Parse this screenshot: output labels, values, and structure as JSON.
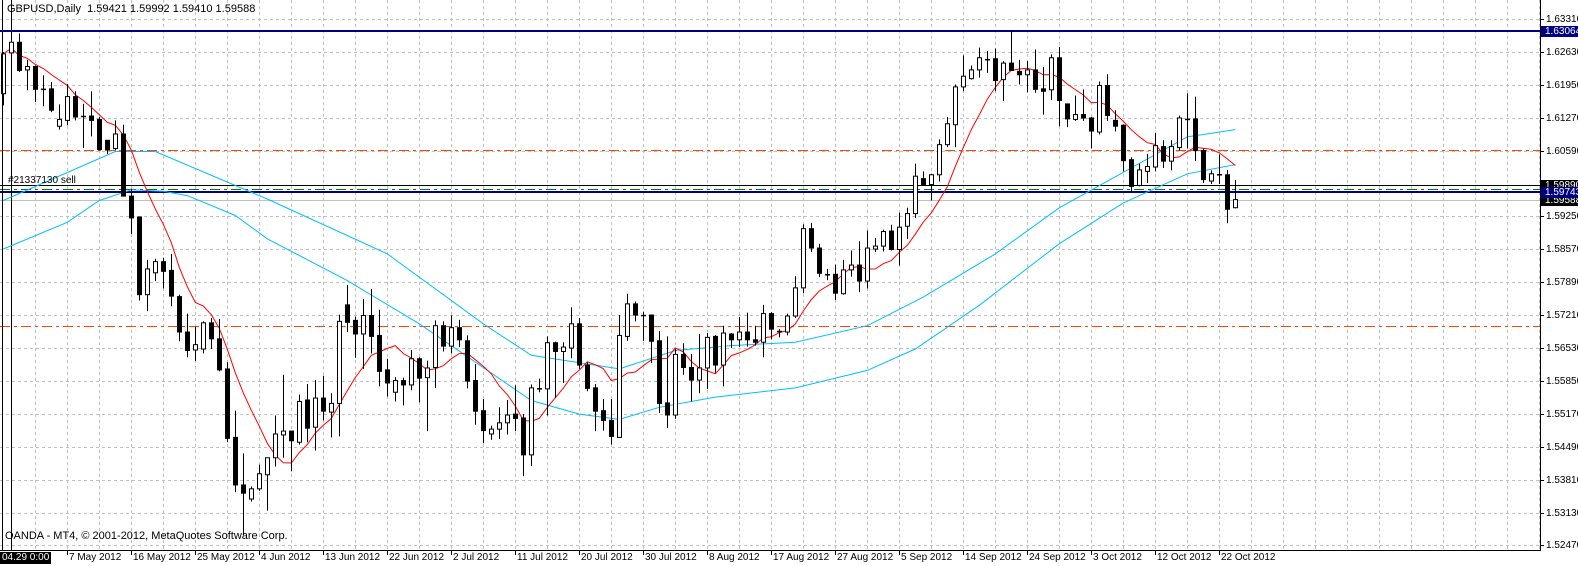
{
  "header": {
    "symbol_timeframe": "GBPUSD,Daily",
    "ohlc": "1.59421 1.59992 1.59410 1.59588"
  },
  "order_label": "#21337130 sell",
  "watermark": "OANDA - MT4, © 2001-2012, MetaQuotes Software Corp.",
  "cursor_time_label": "04.29 0:00",
  "colors": {
    "background": "#ffffff",
    "grid": "#c0c0c0",
    "bull_body": "#ffffff",
    "bear_body": "#000000",
    "candle_outline": "#000000",
    "fast_ma": "#ff0000",
    "slow_ma": "#00bfff",
    "level_line": "#ff4500",
    "resistance_line": "#000080",
    "order_line": "#008000",
    "bid_line": "#c0c0c0"
  },
  "chart_data": {
    "type": "candlestick",
    "title": "GBPUSD,Daily",
    "ylim": [
      1.5237,
      1.637
    ],
    "grid": true,
    "y_ticks": [
      "1.63310",
      "1.62630",
      "1.61950",
      "1.61270",
      "1.60590",
      "1.59250",
      "1.58570",
      "1.57890",
      "1.57210",
      "1.56530",
      "1.55850",
      "1.55170",
      "1.54490",
      "1.53810",
      "1.53130",
      "1.52470"
    ],
    "x_ticks": [
      "7 May 2012",
      "16 May 2012",
      "25 May 2012",
      "4 Jun 2012",
      "13 Jun 2012",
      "22 Jun 2012",
      "2 Jul 2012",
      "11 Jul 2012",
      "20 Jul 2012",
      "30 Jul 2012",
      "8 Aug 2012",
      "17 Aug 2012",
      "27 Aug 2012",
      "5 Sep 2012",
      "14 Sep 2012",
      "24 Sep 2012",
      "3 Oct 2012",
      "12 Oct 2012",
      "22 Oct 2012"
    ],
    "candles_ohlc": [
      [
        1.6177,
        1.6263,
        1.6153,
        1.6259
      ],
      [
        1.6261,
        1.6287,
        1.6246,
        1.6283
      ],
      [
        1.6283,
        1.6301,
        1.6222,
        1.6225
      ],
      [
        1.6226,
        1.6247,
        1.6184,
        1.6233
      ],
      [
        1.6233,
        1.6235,
        1.616,
        1.6186
      ],
      [
        1.6187,
        1.6215,
        1.6151,
        1.6187
      ],
      [
        1.6187,
        1.6201,
        1.6139,
        1.6143
      ],
      [
        1.611,
        1.6155,
        1.6103,
        1.6124
      ],
      [
        1.6122,
        1.6197,
        1.6112,
        1.6171
      ],
      [
        1.6171,
        1.6182,
        1.6122,
        1.6129
      ],
      [
        1.6131,
        1.6156,
        1.6065,
        1.6131
      ],
      [
        1.6131,
        1.6182,
        1.6089,
        1.6122
      ],
      [
        1.6124,
        1.6129,
        1.606,
        1.6062
      ],
      [
        1.6081,
        1.6081,
        1.6053,
        1.6062
      ],
      [
        1.6064,
        1.6122,
        1.606,
        1.6094
      ],
      [
        1.6094,
        1.6113,
        1.5966,
        1.5966
      ],
      [
        1.5966,
        1.5981,
        1.5888,
        1.5921
      ],
      [
        1.5923,
        1.5923,
        1.5751,
        1.5763
      ],
      [
        1.5763,
        1.5835,
        1.5729,
        1.5816
      ],
      [
        1.5808,
        1.5837,
        1.5791,
        1.5831
      ],
      [
        1.5831,
        1.5839,
        1.5776,
        1.5811
      ],
      [
        1.5813,
        1.5847,
        1.5739,
        1.576
      ],
      [
        1.5759,
        1.5763,
        1.5667,
        1.5686
      ],
      [
        1.5686,
        1.5724,
        1.5634,
        1.5648
      ],
      [
        1.5649,
        1.5697,
        1.5626,
        1.566
      ],
      [
        1.5651,
        1.5708,
        1.5642,
        1.5705
      ],
      [
        1.5705,
        1.5715,
        1.5651,
        1.5672
      ],
      [
        1.5672,
        1.5713,
        1.5605,
        1.5608
      ],
      [
        1.561,
        1.5624,
        1.5459,
        1.5467
      ],
      [
        1.5469,
        1.5524,
        1.5356,
        1.5371
      ],
      [
        1.5371,
        1.5436,
        1.5267,
        1.5354
      ],
      [
        1.5342,
        1.5368,
        1.5337,
        1.5363
      ],
      [
        1.5363,
        1.5413,
        1.5359,
        1.5394
      ],
      [
        1.5392,
        1.5427,
        1.5318,
        1.5427
      ],
      [
        1.5427,
        1.5514,
        1.5409,
        1.5476
      ],
      [
        1.5474,
        1.5598,
        1.5427,
        1.5482
      ],
      [
        1.5482,
        1.5482,
        1.5399,
        1.5462
      ],
      [
        1.5459,
        1.5557,
        1.5454,
        1.5543
      ],
      [
        1.5546,
        1.5579,
        1.5459,
        1.5488
      ],
      [
        1.549,
        1.5587,
        1.5442,
        1.555
      ],
      [
        1.555,
        1.5596,
        1.5504,
        1.5523
      ],
      [
        1.5521,
        1.556,
        1.5469,
        1.5539
      ],
      [
        1.5539,
        1.5722,
        1.5471,
        1.5708
      ],
      [
        1.5742,
        1.5783,
        1.5686,
        1.5706
      ],
      [
        1.571,
        1.5718,
        1.5633,
        1.5682
      ],
      [
        1.5682,
        1.5754,
        1.561,
        1.572
      ],
      [
        1.572,
        1.5775,
        1.5642,
        1.5677
      ],
      [
        1.5679,
        1.5732,
        1.5574,
        1.5605
      ],
      [
        1.5608,
        1.5631,
        1.5553,
        1.5581
      ],
      [
        1.5562,
        1.5593,
        1.5543,
        1.5586
      ],
      [
        1.5586,
        1.5592,
        1.5535,
        1.5577
      ],
      [
        1.5577,
        1.5649,
        1.5566,
        1.5631
      ],
      [
        1.5631,
        1.5634,
        1.5541,
        1.5591
      ],
      [
        1.5592,
        1.5627,
        1.5482,
        1.5612
      ],
      [
        1.5613,
        1.571,
        1.5571,
        1.5699
      ],
      [
        1.5699,
        1.5708,
        1.5646,
        1.5657
      ],
      [
        1.5657,
        1.572,
        1.5642,
        1.5695
      ],
      [
        1.5695,
        1.5711,
        1.5655,
        1.567
      ],
      [
        1.5668,
        1.5679,
        1.557,
        1.5585
      ],
      [
        1.5586,
        1.562,
        1.5495,
        1.5523
      ],
      [
        1.5524,
        1.5548,
        1.5457,
        1.5483
      ],
      [
        1.5476,
        1.5493,
        1.5464,
        1.5486
      ],
      [
        1.5486,
        1.5531,
        1.5466,
        1.5499
      ],
      [
        1.5499,
        1.5546,
        1.5475,
        1.5515
      ],
      [
        1.5517,
        1.5576,
        1.5482,
        1.5508
      ],
      [
        1.5509,
        1.5517,
        1.5389,
        1.5433
      ],
      [
        1.5433,
        1.5578,
        1.541,
        1.5571
      ],
      [
        1.557,
        1.559,
        1.5562,
        1.557
      ],
      [
        1.5569,
        1.5677,
        1.5514,
        1.5664
      ],
      [
        1.5664,
        1.5666,
        1.555,
        1.5646
      ],
      [
        1.5646,
        1.5665,
        1.5581,
        1.5655
      ],
      [
        1.5653,
        1.5737,
        1.5632,
        1.5703
      ],
      [
        1.5703,
        1.5715,
        1.561,
        1.5618
      ],
      [
        1.5618,
        1.5624,
        1.5564,
        1.557
      ],
      [
        1.5571,
        1.5579,
        1.5482,
        1.5523
      ],
      [
        1.5524,
        1.5548,
        1.5483,
        1.5504
      ],
      [
        1.5504,
        1.5548,
        1.5454,
        1.5471
      ],
      [
        1.5469,
        1.5721,
        1.5468,
        1.5679
      ],
      [
        1.5677,
        1.5765,
        1.5668,
        1.5744
      ],
      [
        1.5744,
        1.5749,
        1.5708,
        1.5721
      ],
      [
        1.5721,
        1.5728,
        1.5668,
        1.5721
      ],
      [
        1.5721,
        1.5721,
        1.5622,
        1.5667
      ],
      [
        1.5668,
        1.5688,
        1.5519,
        1.5539
      ],
      [
        1.554,
        1.5677,
        1.5488,
        1.5515
      ],
      [
        1.5515,
        1.5651,
        1.5507,
        1.564
      ],
      [
        1.564,
        1.5663,
        1.5598,
        1.5613
      ],
      [
        1.5613,
        1.5641,
        1.5543,
        1.5587
      ],
      [
        1.5587,
        1.5682,
        1.556,
        1.5612
      ],
      [
        1.5612,
        1.5684,
        1.5569,
        1.5675
      ],
      [
        1.5677,
        1.568,
        1.5602,
        1.5618
      ],
      [
        1.5618,
        1.5699,
        1.5574,
        1.5684
      ],
      [
        1.5682,
        1.5684,
        1.5653,
        1.567
      ],
      [
        1.567,
        1.5717,
        1.5655,
        1.5686
      ],
      [
        1.5686,
        1.5726,
        1.5656,
        1.567
      ],
      [
        1.567,
        1.5699,
        1.5658,
        1.5665
      ],
      [
        1.5665,
        1.5742,
        1.5634,
        1.5724
      ],
      [
        1.5724,
        1.5727,
        1.5671,
        1.5692
      ],
      [
        1.5688,
        1.5692,
        1.5675,
        1.5688
      ],
      [
        1.5686,
        1.5724,
        1.5679,
        1.5719
      ],
      [
        1.5719,
        1.5801,
        1.5715,
        1.5777
      ],
      [
        1.5777,
        1.5908,
        1.5766,
        1.5899
      ],
      [
        1.5899,
        1.5911,
        1.5851,
        1.5859
      ],
      [
        1.5859,
        1.5868,
        1.5799,
        1.5807
      ],
      [
        1.5805,
        1.5816,
        1.5793,
        1.5805
      ],
      [
        1.5805,
        1.5825,
        1.5752,
        1.5766
      ],
      [
        1.5765,
        1.5835,
        1.5763,
        1.5814
      ],
      [
        1.5814,
        1.5854,
        1.58,
        1.5824
      ],
      [
        1.5824,
        1.5873,
        1.5768,
        1.5791
      ],
      [
        1.5791,
        1.5895,
        1.5776,
        1.5859
      ],
      [
        1.5857,
        1.588,
        1.5851,
        1.5863
      ],
      [
        1.5863,
        1.5897,
        1.5852,
        1.5893
      ],
      [
        1.5894,
        1.5907,
        1.5854,
        1.5856
      ],
      [
        1.5856,
        1.5932,
        1.5823,
        1.5902
      ],
      [
        1.5904,
        1.5942,
        1.5878,
        1.593
      ],
      [
        1.593,
        1.6033,
        1.5921,
        1.6007
      ],
      [
        1.6002,
        1.6017,
        1.599,
        1.599
      ],
      [
        1.599,
        1.6012,
        1.5957,
        1.601
      ],
      [
        1.601,
        1.6083,
        1.5996,
        1.6072
      ],
      [
        1.6072,
        1.6129,
        1.6067,
        1.6115
      ],
      [
        1.6113,
        1.6196,
        1.6067,
        1.6191
      ],
      [
        1.6191,
        1.6256,
        1.6182,
        1.6213
      ],
      [
        1.6208,
        1.6235,
        1.6206,
        1.6226
      ],
      [
        1.6226,
        1.6272,
        1.621,
        1.6251
      ],
      [
        1.6248,
        1.6265,
        1.622,
        1.6248
      ],
      [
        1.6249,
        1.627,
        1.6182,
        1.6204
      ],
      [
        1.6206,
        1.6244,
        1.6162,
        1.624
      ],
      [
        1.624,
        1.6307,
        1.6224,
        1.6225
      ],
      [
        1.6223,
        1.6247,
        1.6196,
        1.6216
      ],
      [
        1.6216,
        1.6244,
        1.618,
        1.6226
      ],
      [
        1.6226,
        1.6268,
        1.6179,
        1.6186
      ],
      [
        1.6187,
        1.6232,
        1.6134,
        1.6182
      ],
      [
        1.6185,
        1.6258,
        1.6164,
        1.6251
      ],
      [
        1.6251,
        1.6273,
        1.611,
        1.6163
      ],
      [
        1.6156,
        1.6156,
        1.6108,
        1.6125
      ],
      [
        1.6124,
        1.6173,
        1.6121,
        1.6134
      ],
      [
        1.6134,
        1.6186,
        1.6121,
        1.6127
      ],
      [
        1.6127,
        1.6129,
        1.6064,
        1.61
      ],
      [
        1.6098,
        1.6202,
        1.6093,
        1.6194
      ],
      [
        1.6194,
        1.6217,
        1.6121,
        1.6132
      ],
      [
        1.6122,
        1.6143,
        1.6099,
        1.611
      ],
      [
        1.6112,
        1.6114,
        1.6017,
        1.6039
      ],
      [
        1.6041,
        1.6046,
        1.5976,
        1.5986
      ],
      [
        1.5988,
        1.6033,
        1.5986,
        1.602
      ],
      [
        1.6017,
        1.6053,
        1.5993,
        1.6027
      ],
      [
        1.6026,
        1.6096,
        1.6017,
        1.607
      ],
      [
        1.6068,
        1.6081,
        1.6024,
        1.6038
      ],
      [
        1.6038,
        1.6081,
        1.6019,
        1.6068
      ],
      [
        1.6066,
        1.6132,
        1.606,
        1.6127
      ],
      [
        1.6125,
        1.6178,
        1.6064,
        1.6125
      ],
      [
        1.6125,
        1.6171,
        1.6038,
        1.606
      ],
      [
        1.606,
        1.6064,
        1.5993,
        1.6
      ],
      [
        1.5997,
        1.6019,
        1.5991,
        1.6012
      ],
      [
        1.6011,
        1.6052,
        1.5991,
        1.6011
      ],
      [
        1.601,
        1.602,
        1.591,
        1.5939
      ],
      [
        1.59421,
        1.59992,
        1.5941,
        1.59588
      ]
    ],
    "indicator_lines": [
      {
        "color": "#00bfff",
        "points": [
          [
            0,
            1.5957
          ],
          [
            14,
            1.6058
          ],
          [
            19,
            1.6058
          ],
          [
            33,
            1.596
          ],
          [
            48,
            1.5847
          ],
          [
            60,
            1.5703
          ],
          [
            66,
            1.5638
          ],
          [
            77,
            1.561
          ],
          [
            84,
            1.5648
          ],
          [
            91,
            1.5658
          ],
          [
            99,
            1.5665
          ],
          [
            108,
            1.5699
          ],
          [
            115,
            1.5758
          ],
          [
            124,
            1.5847
          ],
          [
            132,
            1.5942
          ],
          [
            140,
            1.6015
          ],
          [
            148,
            1.6088
          ],
          [
            154,
            1.6103
          ]
        ]
      },
      {
        "color": "#00bfff",
        "points": [
          [
            0,
            1.5857
          ],
          [
            8,
            1.5912
          ],
          [
            12,
            1.5957
          ],
          [
            16,
            1.5979
          ],
          [
            20,
            1.5976
          ],
          [
            23,
            1.5967
          ],
          [
            29,
            1.5926
          ],
          [
            33,
            1.5878
          ],
          [
            43,
            1.5792
          ],
          [
            52,
            1.5703
          ],
          [
            59,
            1.5624
          ],
          [
            66,
            1.5545
          ],
          [
            72,
            1.5517
          ],
          [
            77,
            1.5506
          ],
          [
            82,
            1.5531
          ],
          [
            89,
            1.5552
          ],
          [
            99,
            1.5571
          ],
          [
            108,
            1.5607
          ],
          [
            114,
            1.5651
          ],
          [
            122,
            1.5741
          ],
          [
            132,
            1.5868
          ],
          [
            140,
            1.5952
          ],
          [
            148,
            1.6012
          ],
          [
            154,
            1.6031
          ]
        ]
      }
    ],
    "fast_ma_color": "#ff0000",
    "horizontal_lines": [
      {
        "price": 1.63064,
        "color": "#000080",
        "style": "solid",
        "width": 2,
        "tag": "1.63064",
        "tag_color": "#000080"
      },
      {
        "price": 1.606,
        "color": "#ff4500",
        "style": "dashdot",
        "width": 1
      },
      {
        "price": 1.5699,
        "color": "#ff4500",
        "style": "dashdot",
        "width": 1
      },
      {
        "price": 1.5989,
        "color": "#000000",
        "style": "solid",
        "width": 1,
        "tag": "1.59890",
        "tag_color": "#000000"
      },
      {
        "price": 1.5981,
        "color": "#008000",
        "style": "dashdot",
        "width": 1
      },
      {
        "price": 1.59588,
        "color": "#c0c0c0",
        "style": "solid",
        "width": 1,
        "tag": "1.59588",
        "tag_color": "#000000"
      },
      {
        "price": 1.59743,
        "color": "#000080",
        "style": "solid",
        "width": 2,
        "tag": "1.59743",
        "tag_color": "#000080"
      }
    ],
    "vertical_line_index": 1
  }
}
